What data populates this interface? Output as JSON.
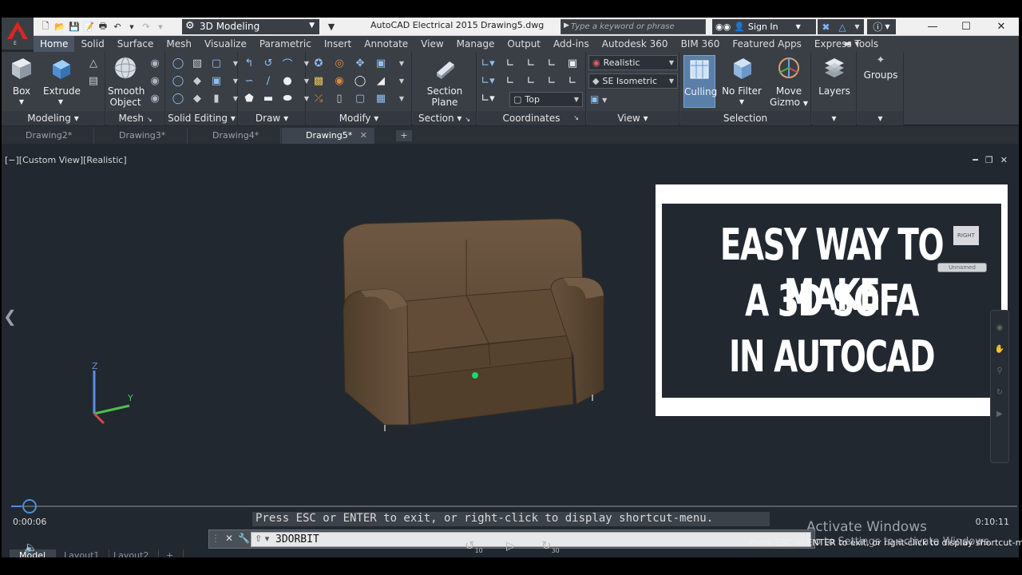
{
  "app": {
    "logo_sub": "E",
    "workspace": "3D Modeling",
    "title": "AutoCAD Electrical 2015",
    "file": "Drawing5.dwg",
    "search_placeholder": "Type a keyword or phrase",
    "sign_in": "Sign In"
  },
  "ribbon": {
    "tabs": [
      "Home",
      "Solid",
      "Surface",
      "Mesh",
      "Visualize",
      "Parametric",
      "Insert",
      "Annotate",
      "View",
      "Manage",
      "Output",
      "Add-ins",
      "Autodesk 360",
      "BIM 360",
      "Featured Apps",
      "Express Tools"
    ],
    "active_tab": "Home",
    "box": "Box",
    "extrude": "Extrude",
    "smooth": "Smooth",
    "object": "Object",
    "section": "Section",
    "plane": "Plane",
    "visual_style": "Realistic",
    "view_dir": "SE Isometric",
    "ucs": "Top",
    "culling": "Culling",
    "no_filter": "No Filter",
    "move": "Move",
    "gizmo": "Gizmo",
    "layers": "Layers",
    "groups": "Groups",
    "panels": {
      "modeling": "Modeling",
      "mesh": "Mesh",
      "solid_editing": "Solid Editing",
      "draw": "Draw",
      "modify": "Modify",
      "section": "Section",
      "coordinates": "Coordinates",
      "view": "View",
      "selection": "Selection"
    }
  },
  "file_tabs": [
    "Drawing2*",
    "Drawing3*",
    "Drawing4*",
    "Drawing5*"
  ],
  "viewport": {
    "label": "[−][Custom View][Realistic]",
    "axis_z": "Z",
    "axis_y": "Y"
  },
  "thumbnail": {
    "line1": "EASY WAY TO MAKE",
    "line2": "A 3D SOFA",
    "line3": "IN AUTOCAD",
    "cube_face": "RIGHT",
    "ucs_name": "Unnamed"
  },
  "command": {
    "prompt": "Press ESC or ENTER to exit, or right-click to display shortcut-menu.",
    "input": "3DORBIT"
  },
  "watermark": {
    "title": "Activate Windows",
    "sub": "Go to Settings to activate Windows."
  },
  "video": {
    "current_time": "0:00:06",
    "total_time": "0:10:11",
    "progress": 0.01,
    "skip_back": "10",
    "skip_fwd": "30"
  },
  "layout_tabs": [
    "Model",
    "Layout1",
    "Layout2"
  ],
  "status_text": "Press ESC or ENTER to exit, or right-click to display shortcut-menu.",
  "colors": {
    "sofa": "#5b4836",
    "viewport_bg": "#212830",
    "ribbon_bg": "#3a3f46",
    "accent": "#4a8fd8"
  }
}
